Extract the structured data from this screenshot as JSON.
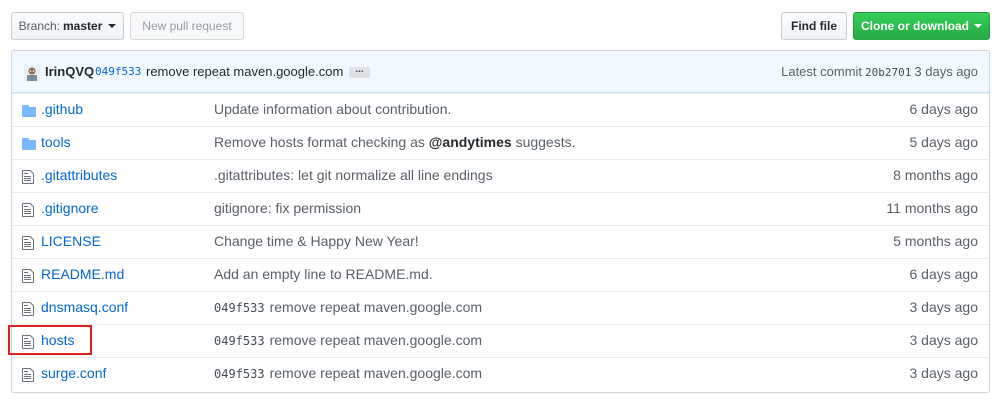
{
  "toolbar": {
    "branch_label": "Branch:",
    "branch_value": "master",
    "new_pr_label": "New pull request",
    "find_file_label": "Find file",
    "clone_label": "Clone or download"
  },
  "commit": {
    "author": "IrinQVQ",
    "sha": "049f533",
    "message": "remove repeat maven.google.com",
    "ellipsis": "...",
    "latest_label": "Latest commit",
    "latest_sha": "20b2701",
    "latest_age": "3 days ago"
  },
  "files": [
    {
      "type": "dir",
      "name": ".github",
      "sha": "",
      "message": "Update information about contribution.",
      "age": "6 days ago"
    },
    {
      "type": "dir",
      "name": "tools",
      "sha": "",
      "message": "Remove hosts format checking as",
      "mention": "@andytimes",
      "message_after": "suggests.",
      "age": "5 days ago"
    },
    {
      "type": "file",
      "name": ".gitattributes",
      "sha": "",
      "message": ".gitattributes: let git normalize all line endings",
      "age": "8 months ago"
    },
    {
      "type": "file",
      "name": ".gitignore",
      "sha": "",
      "message": "gitignore: fix permission",
      "age": "11 months ago"
    },
    {
      "type": "file",
      "name": "LICENSE",
      "sha": "",
      "message": "Change time & Happy New Year!",
      "age": "5 months ago"
    },
    {
      "type": "file",
      "name": "README.md",
      "sha": "",
      "message": "Add an empty line to README.md.",
      "age": "6 days ago"
    },
    {
      "type": "file",
      "name": "dnsmasq.conf",
      "sha": "049f533",
      "message": "remove repeat maven.google.com",
      "age": "3 days ago"
    },
    {
      "type": "file",
      "name": "hosts",
      "sha": "049f533",
      "message": "remove repeat maven.google.com",
      "age": "3 days ago"
    },
    {
      "type": "file",
      "name": "surge.conf",
      "sha": "049f533",
      "message": "remove repeat maven.google.com",
      "age": "3 days ago"
    }
  ],
  "icons": {
    "dir": "folder-icon",
    "file": "file-icon"
  },
  "colors": {
    "link": "#0366d6",
    "clone_green": "#28a745",
    "highlight": "#e02020",
    "commit_bg": "#f1f8ff"
  }
}
